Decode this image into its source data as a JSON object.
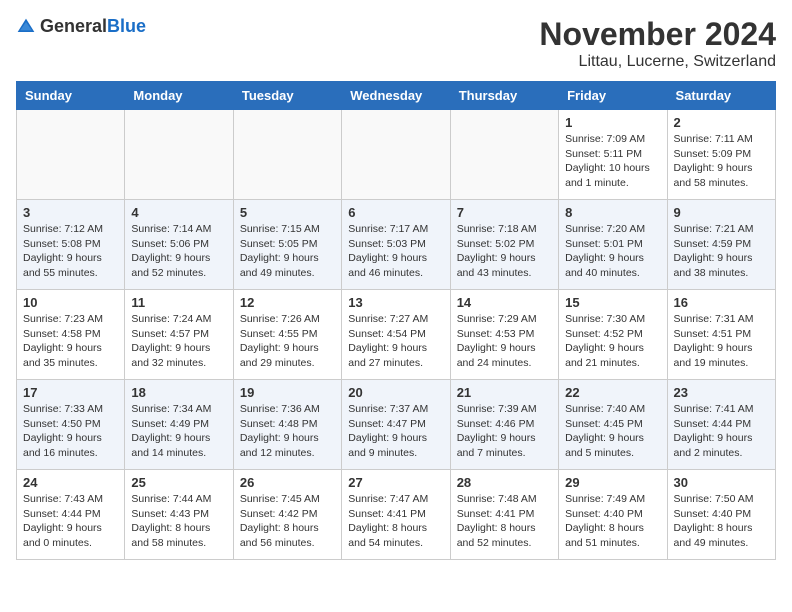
{
  "header": {
    "logo_general": "General",
    "logo_blue": "Blue",
    "month_title": "November 2024",
    "location": "Littau, Lucerne, Switzerland"
  },
  "weekdays": [
    "Sunday",
    "Monday",
    "Tuesday",
    "Wednesday",
    "Thursday",
    "Friday",
    "Saturday"
  ],
  "weeks": [
    [
      {
        "day": "",
        "info": ""
      },
      {
        "day": "",
        "info": ""
      },
      {
        "day": "",
        "info": ""
      },
      {
        "day": "",
        "info": ""
      },
      {
        "day": "",
        "info": ""
      },
      {
        "day": "1",
        "info": "Sunrise: 7:09 AM\nSunset: 5:11 PM\nDaylight: 10 hours and 1 minute."
      },
      {
        "day": "2",
        "info": "Sunrise: 7:11 AM\nSunset: 5:09 PM\nDaylight: 9 hours and 58 minutes."
      }
    ],
    [
      {
        "day": "3",
        "info": "Sunrise: 7:12 AM\nSunset: 5:08 PM\nDaylight: 9 hours and 55 minutes."
      },
      {
        "day": "4",
        "info": "Sunrise: 7:14 AM\nSunset: 5:06 PM\nDaylight: 9 hours and 52 minutes."
      },
      {
        "day": "5",
        "info": "Sunrise: 7:15 AM\nSunset: 5:05 PM\nDaylight: 9 hours and 49 minutes."
      },
      {
        "day": "6",
        "info": "Sunrise: 7:17 AM\nSunset: 5:03 PM\nDaylight: 9 hours and 46 minutes."
      },
      {
        "day": "7",
        "info": "Sunrise: 7:18 AM\nSunset: 5:02 PM\nDaylight: 9 hours and 43 minutes."
      },
      {
        "day": "8",
        "info": "Sunrise: 7:20 AM\nSunset: 5:01 PM\nDaylight: 9 hours and 40 minutes."
      },
      {
        "day": "9",
        "info": "Sunrise: 7:21 AM\nSunset: 4:59 PM\nDaylight: 9 hours and 38 minutes."
      }
    ],
    [
      {
        "day": "10",
        "info": "Sunrise: 7:23 AM\nSunset: 4:58 PM\nDaylight: 9 hours and 35 minutes."
      },
      {
        "day": "11",
        "info": "Sunrise: 7:24 AM\nSunset: 4:57 PM\nDaylight: 9 hours and 32 minutes."
      },
      {
        "day": "12",
        "info": "Sunrise: 7:26 AM\nSunset: 4:55 PM\nDaylight: 9 hours and 29 minutes."
      },
      {
        "day": "13",
        "info": "Sunrise: 7:27 AM\nSunset: 4:54 PM\nDaylight: 9 hours and 27 minutes."
      },
      {
        "day": "14",
        "info": "Sunrise: 7:29 AM\nSunset: 4:53 PM\nDaylight: 9 hours and 24 minutes."
      },
      {
        "day": "15",
        "info": "Sunrise: 7:30 AM\nSunset: 4:52 PM\nDaylight: 9 hours and 21 minutes."
      },
      {
        "day": "16",
        "info": "Sunrise: 7:31 AM\nSunset: 4:51 PM\nDaylight: 9 hours and 19 minutes."
      }
    ],
    [
      {
        "day": "17",
        "info": "Sunrise: 7:33 AM\nSunset: 4:50 PM\nDaylight: 9 hours and 16 minutes."
      },
      {
        "day": "18",
        "info": "Sunrise: 7:34 AM\nSunset: 4:49 PM\nDaylight: 9 hours and 14 minutes."
      },
      {
        "day": "19",
        "info": "Sunrise: 7:36 AM\nSunset: 4:48 PM\nDaylight: 9 hours and 12 minutes."
      },
      {
        "day": "20",
        "info": "Sunrise: 7:37 AM\nSunset: 4:47 PM\nDaylight: 9 hours and 9 minutes."
      },
      {
        "day": "21",
        "info": "Sunrise: 7:39 AM\nSunset: 4:46 PM\nDaylight: 9 hours and 7 minutes."
      },
      {
        "day": "22",
        "info": "Sunrise: 7:40 AM\nSunset: 4:45 PM\nDaylight: 9 hours and 5 minutes."
      },
      {
        "day": "23",
        "info": "Sunrise: 7:41 AM\nSunset: 4:44 PM\nDaylight: 9 hours and 2 minutes."
      }
    ],
    [
      {
        "day": "24",
        "info": "Sunrise: 7:43 AM\nSunset: 4:44 PM\nDaylight: 9 hours and 0 minutes."
      },
      {
        "day": "25",
        "info": "Sunrise: 7:44 AM\nSunset: 4:43 PM\nDaylight: 8 hours and 58 minutes."
      },
      {
        "day": "26",
        "info": "Sunrise: 7:45 AM\nSunset: 4:42 PM\nDaylight: 8 hours and 56 minutes."
      },
      {
        "day": "27",
        "info": "Sunrise: 7:47 AM\nSunset: 4:41 PM\nDaylight: 8 hours and 54 minutes."
      },
      {
        "day": "28",
        "info": "Sunrise: 7:48 AM\nSunset: 4:41 PM\nDaylight: 8 hours and 52 minutes."
      },
      {
        "day": "29",
        "info": "Sunrise: 7:49 AM\nSunset: 4:40 PM\nDaylight: 8 hours and 51 minutes."
      },
      {
        "day": "30",
        "info": "Sunrise: 7:50 AM\nSunset: 4:40 PM\nDaylight: 8 hours and 49 minutes."
      }
    ]
  ]
}
